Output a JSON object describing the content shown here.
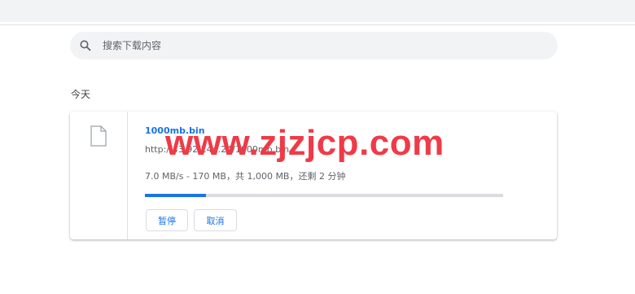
{
  "search": {
    "placeholder": "搜索下载内容",
    "icon": "search-icon"
  },
  "section": {
    "label": "今天"
  },
  "download": {
    "file_name": "1000mb.bin",
    "url": "http://43.92.144.24/1000mb.bin",
    "status": "7.0 MB/s - 170 MB，共 1,000 MB，还剩 2 分钟",
    "progress_fraction": 0.17,
    "pause_label": "暂停",
    "cancel_label": "取消"
  },
  "watermark": {
    "text": "www.zjzjcp.com"
  },
  "colors": {
    "accent": "#1a73e8",
    "watermark": "#f03a47"
  }
}
